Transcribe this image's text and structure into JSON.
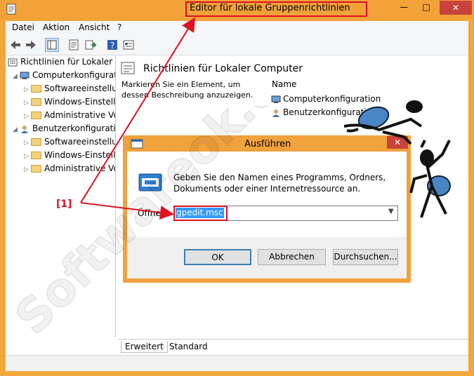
{
  "window": {
    "title": "Editor für lokale Gruppenrichtlinien",
    "close_glyph": "✕"
  },
  "menu": [
    "Datei",
    "Aktion",
    "Ansicht",
    "?"
  ],
  "tree": {
    "root": "Richtlinien für Lokaler C",
    "items": [
      {
        "label": "Computerkonfigurati",
        "level": 1
      },
      {
        "label": "Softwareeinstellu",
        "level": 2
      },
      {
        "label": "Windows-Einstell",
        "level": 2
      },
      {
        "label": "Administrative Vo",
        "level": 2
      },
      {
        "label": "Benutzerkonfigurati",
        "level": 1
      },
      {
        "label": "Softwareeinstellu",
        "level": 2
      },
      {
        "label": "Windows-Einstell",
        "level": 2
      },
      {
        "label": "Administrative Vo",
        "level": 2
      }
    ]
  },
  "right_pane": {
    "header": "Richtlinien für Lokaler Computer",
    "description": "Markieren Sie ein Element, um dessen Beschreibung anzuzeigen.",
    "name_header": "Name",
    "items": [
      "Computerkonfiguration",
      "Benutzerkonfiguration"
    ]
  },
  "tabs": [
    "Erweitert",
    "Standard"
  ],
  "dialog": {
    "title": "Ausführen",
    "message": "Geben Sie den Namen eines Programms, Ordners, Dokuments oder einer Internetressource an.",
    "open_label": "Öffnen:",
    "input_value": "gpedit.msc",
    "ok": "OK",
    "cancel": "Abbrechen",
    "browse": "Durchsuchen..."
  },
  "annotation": "[1]",
  "watermark": "Softwareok.de",
  "colors": {
    "frame": "#f3a23a",
    "highlight": "#e01020",
    "selection": "#3399ff"
  }
}
